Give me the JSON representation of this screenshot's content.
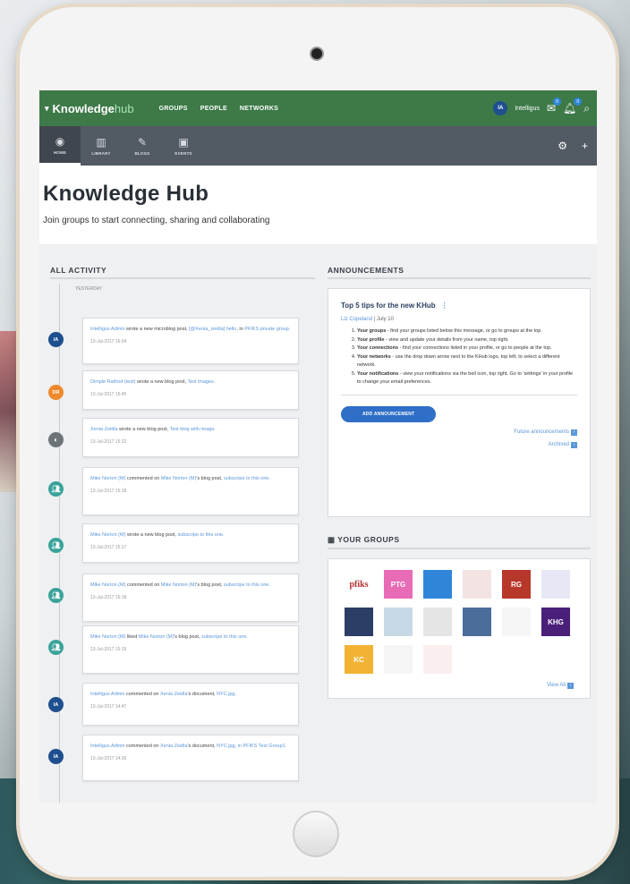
{
  "app": {
    "logo_main": "Knowledge",
    "logo_hub": "hub",
    "top_nav": [
      "GROUPS",
      "PEOPLE",
      "NETWORKS"
    ],
    "user_initials": "IA",
    "user_name": "Intelligus",
    "mail_badge": "0",
    "bell_badge": "0"
  },
  "subnav": [
    {
      "label": "HOME",
      "icon": "globe-icon",
      "glyph": "◉"
    },
    {
      "label": "LIBRARY",
      "icon": "library-icon",
      "glyph": "▥"
    },
    {
      "label": "BLOGS",
      "icon": "blog-icon",
      "glyph": "✎"
    },
    {
      "label": "EVENTS",
      "icon": "calendar-icon",
      "glyph": "▣"
    }
  ],
  "page": {
    "title": "Knowledge Hub",
    "subtitle": "Join groups to start connecting, sharing and collaborating"
  },
  "activity": {
    "heading": "ALL ACTIVITY",
    "day": "YESTERDAY",
    "items": [
      {
        "avatar": "IA",
        "p1": "Intelligus Admin",
        "p2": " wrote a new microblog post, ",
        "p3": "[@Xenia_zeidla] hello",
        "p4": ", in ",
        "p5": "PFIKS private group.",
        "date": "13-Jul-2017 16:34"
      },
      {
        "avatar": "DR",
        "p1": "Dimple Rathod (test)",
        "p2": " wrote a new blog post, ",
        "p3": "Test images.",
        "p4": "",
        "p5": "",
        "date": "13-Jul-2017 15:45"
      },
      {
        "avatar": "",
        "p1": "Xenia Zeidla",
        "p2": " wrote a new blog post, ",
        "p3": "Test blog with image.",
        "p4": "",
        "p5": "",
        "date": "13-Jul-2017 15:22"
      },
      {
        "avatar": "",
        "p1": "Mike Norton (M)",
        "p2": " commented on ",
        "p3": "Mike Norton (M)",
        "p4": "'s blog post, ",
        "p5": "subscripe to this one.",
        "date": "13-Jul-2017 15:18"
      },
      {
        "avatar": "",
        "p1": "Mike Norton (M)",
        "p2": " wrote a new blog post, ",
        "p3": "subscripe to this one.",
        "p4": "",
        "p5": "",
        "date": "13-Jul-2017 15:17"
      },
      {
        "avatar": "",
        "p1": "Mike Norton (M)",
        "p2": " commented on ",
        "p3": "Mike Norton (M)",
        "p4": "'s blog post, ",
        "p5": "subscripe to this one.",
        "date": "13-Jul-2017 15:18"
      },
      {
        "avatar": "",
        "p1": "Mike Norton (M)",
        "p2": " liked ",
        "p3": "Mike Norton (M)",
        "p4": "'s blog post, ",
        "p5": "subscripe to this one.",
        "date": "13-Jul-2017 15:19"
      },
      {
        "avatar": "IA",
        "p1": "Intelligus Admin",
        "p2": " commented on ",
        "p3": "Xenia Zeidla",
        "p4": "'s document, ",
        "p5": "NYC.jpg.",
        "date": "13-Jul-2017 14:47"
      },
      {
        "avatar": "IA",
        "p1": "Intelligus Admin",
        "p2": " commented on ",
        "p3": "Xenia Zeidla",
        "p4": "'s document, ",
        "p5": "NYC.jpg, in PFIKS Test Group1.",
        "date": "13-Jul-2017 14:26"
      }
    ]
  },
  "announcements": {
    "heading": "ANNOUNCEMENTS",
    "title": "Top 5 tips for the new KHub",
    "author": "Liz Copeland",
    "date": "| July 10",
    "tips": [
      {
        "b": "Your groups",
        "t": " - find your groups listed below this message, or go to groups at the top."
      },
      {
        "b": "Your profile",
        "t": " - view and update your details from your name, top right."
      },
      {
        "b": "Your connections",
        "t": " - find your connections listed in your profile, or go to people at the top."
      },
      {
        "b": "Your networks",
        "t": " - use the drop down arrow next to the KHub logo, top left, to select a different network."
      },
      {
        "b": "Your notifications",
        "t": " - view your notifications via the bell icon, top right. Go to 'settings' in your profile to change your email preferences."
      }
    ],
    "button": "ADD ANNOUNCEMENT",
    "future": "Future announcements",
    "archived": "Archived"
  },
  "groups": {
    "heading": "YOUR GROUPS",
    "tiles": [
      {
        "label": "pfiks",
        "bg": "#ffffff",
        "fg": "#b03030"
      },
      {
        "label": "PTG",
        "bg": "#e86bb5",
        "fg": "#ffffff"
      },
      {
        "label": "",
        "bg": "#2f86d8",
        "fg": "#ffffff"
      },
      {
        "label": "",
        "bg": "#f3e3e3",
        "fg": "#ffffff"
      },
      {
        "label": "RG",
        "bg": "#b8372b",
        "fg": "#ffffff"
      },
      {
        "label": "",
        "bg": "#e6e9f5",
        "fg": "#ffffff"
      },
      {
        "label": "",
        "bg": "#2c3e66",
        "fg": "#ffffff"
      },
      {
        "label": "",
        "bg": "#c8d9e6",
        "fg": "#ffffff"
      },
      {
        "label": "",
        "bg": "#e5e5e5",
        "fg": "#ffffff"
      },
      {
        "label": "",
        "bg": "#4a6d9a",
        "fg": "#ffffff"
      },
      {
        "label": "",
        "bg": "#f5f5f5",
        "fg": "#ffffff"
      },
      {
        "label": "KHG",
        "bg": "#4a1f7a",
        "fg": "#ffffff"
      },
      {
        "label": "KC",
        "bg": "#f2b234",
        "fg": "#ffffff"
      },
      {
        "label": "",
        "bg": "#f5f5f5",
        "fg": "#ffffff"
      },
      {
        "label": "",
        "bg": "#fbeeee",
        "fg": "#ffffff"
      }
    ],
    "view_all": "View All"
  }
}
